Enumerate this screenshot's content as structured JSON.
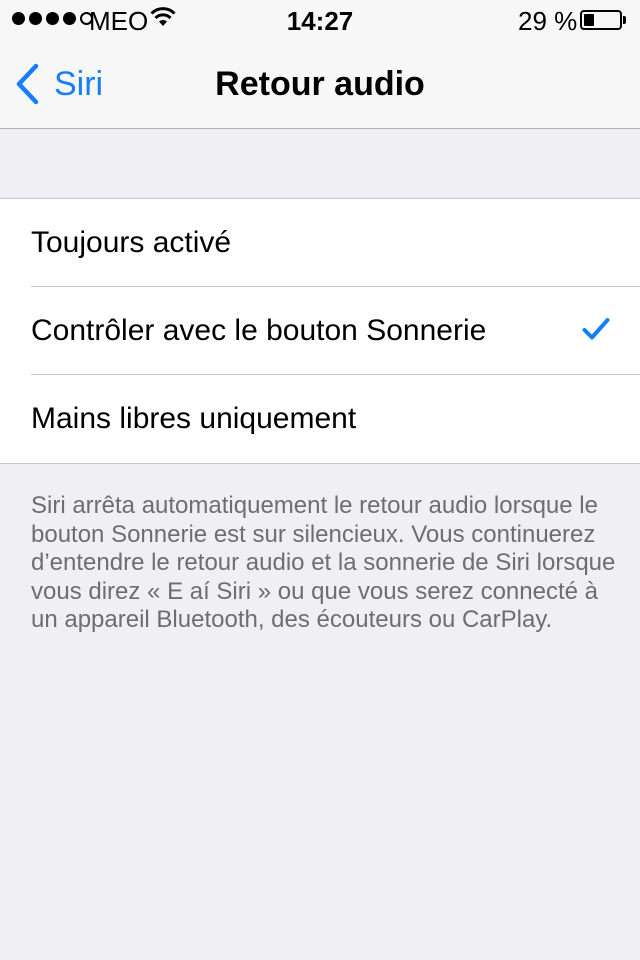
{
  "status_bar": {
    "carrier": "MEO",
    "time": "14:27",
    "battery_percent": "29 %",
    "battery_level": 0.29,
    "signal_strength": 4
  },
  "nav": {
    "back_label": "Siri",
    "title": "Retour audio"
  },
  "options": [
    {
      "label": "Toujours activé",
      "selected": false
    },
    {
      "label": "Contrôler avec le bouton Sonnerie",
      "selected": true
    },
    {
      "label": "Mains libres uniquement",
      "selected": false
    }
  ],
  "footer": {
    "text": "Siri arrêta automatiquement le retour audio lorsque le bouton Sonnerie est sur silencieux. Vous continuerez d’entendre le retour audio et la sonnerie de Siri lorsque vous direz « E aí Siri » ou que vous serez connecté à un appareil Bluetooth, des écouteurs ou CarPlay."
  },
  "colors": {
    "accent": "#157efb",
    "background": "#efeff4",
    "footer_text": "#6d6d72"
  }
}
